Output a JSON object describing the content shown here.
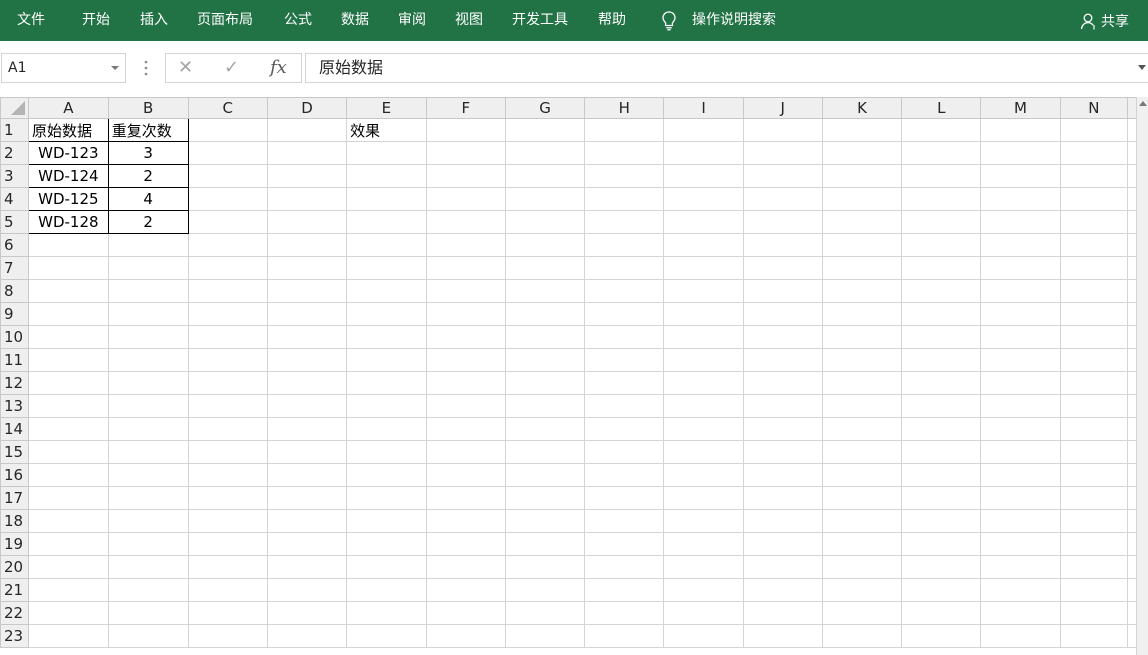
{
  "ribbon": {
    "tabs": [
      "文件",
      "开始",
      "插入",
      "页面布局",
      "公式",
      "数据",
      "审阅",
      "视图",
      "开发工具",
      "帮助"
    ],
    "tell_me": "操作说明搜索",
    "share": "共享",
    "bg_color": "#217346"
  },
  "formula_bar": {
    "name_box": "A1",
    "cancel_icon": "✕",
    "enter_icon": "✓",
    "fx_label": "fx",
    "formula": "原始数据"
  },
  "sheet": {
    "columns": [
      "A",
      "B",
      "C",
      "D",
      "E",
      "F",
      "G",
      "H",
      "I",
      "J",
      "K",
      "L",
      "M",
      "N"
    ],
    "rows": [
      "1",
      "2",
      "3",
      "4",
      "5",
      "6",
      "7",
      "8",
      "9",
      "10",
      "11",
      "12",
      "13",
      "14",
      "15",
      "16",
      "17",
      "18",
      "19",
      "20",
      "21",
      "22",
      "23"
    ],
    "cells": {
      "A1": "原始数据",
      "B1": "重复次数",
      "E1": "效果",
      "A2": "WD-123",
      "B2": "3",
      "A3": "WD-124",
      "B3": "2",
      "A4": "WD-125",
      "B4": "4",
      "A5": "WD-128",
      "B5": "2"
    }
  }
}
